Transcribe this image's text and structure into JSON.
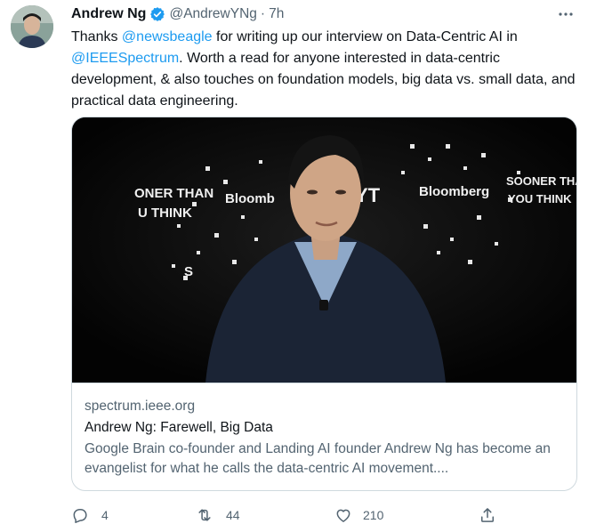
{
  "tweet": {
    "author": {
      "display_name": "Andrew Ng",
      "handle": "@AndrewYNg",
      "verified": true,
      "avatar_icon": "profile-photo"
    },
    "separator": "·",
    "timestamp": "7h",
    "more_icon": "ellipsis-icon",
    "text": {
      "part1": "Thanks ",
      "mention1": "@newsbeagle",
      "part2": " for writing up our interview on Data-Centric AI in ",
      "mention2": "@IEEESpectrum",
      "part3": ". Worth a read for anyone interested in data-centric development, & also touches on foundation models, big data vs. small data, and practical data engineering."
    },
    "card": {
      "image_icon": "photo-of-speaker-on-stage",
      "image_backdrop_text": [
        "ONER THAN",
        "U THINK",
        "Bloomb",
        "YT",
        "Bloomberg",
        "SOONER THA",
        "YOU THINK",
        "S"
      ],
      "domain": "spectrum.ieee.org",
      "title": "Andrew Ng: Farewell, Big Data",
      "description": "Google Brain co-founder and Landing AI founder Andrew Ng has become an evangelist for what he calls the data-centric AI movement...."
    },
    "actions": {
      "reply": {
        "icon": "reply-icon",
        "count": "4"
      },
      "retweet": {
        "icon": "retweet-icon",
        "count": "44"
      },
      "like": {
        "icon": "heart-icon",
        "count": "210"
      },
      "share": {
        "icon": "share-icon"
      }
    }
  },
  "colors": {
    "link": "#1d9bf0",
    "secondary_text": "#536471",
    "primary_text": "#0f1419",
    "border": "#cfd9de",
    "verified_badge": "#1d9bf0"
  }
}
